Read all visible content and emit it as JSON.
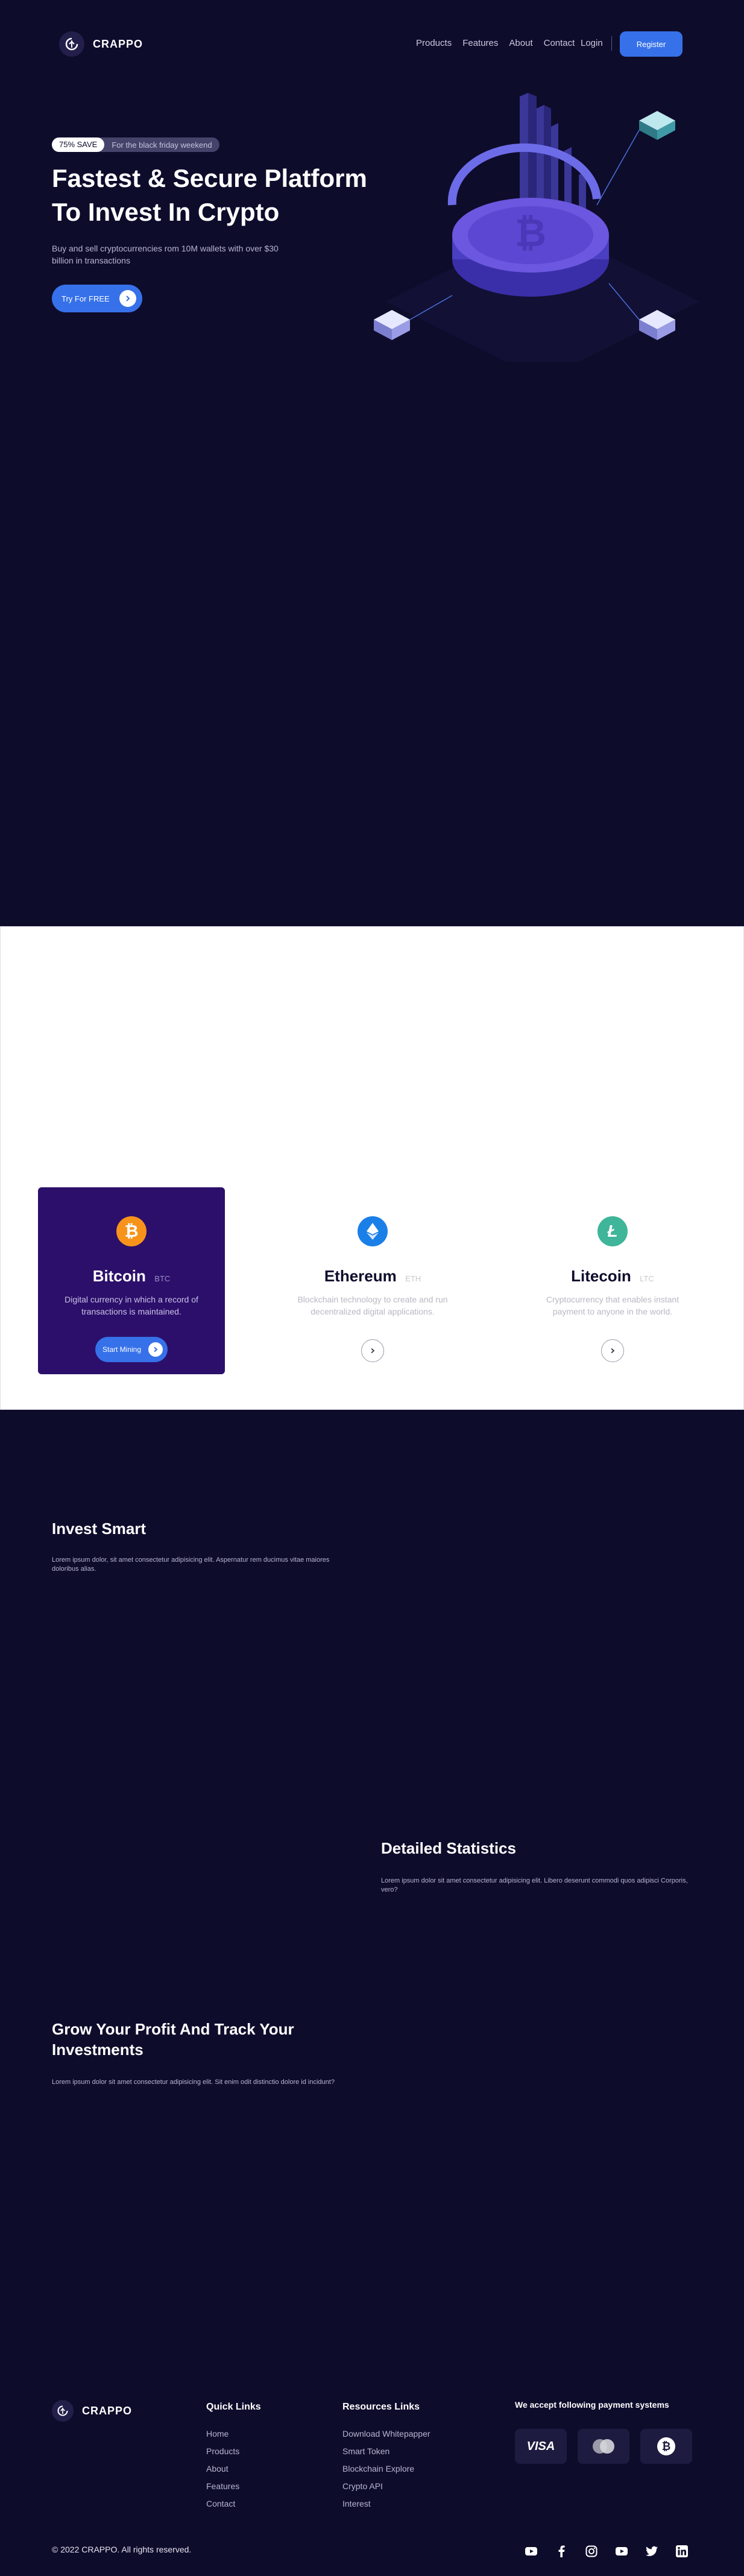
{
  "nav": {
    "brand": "CRAPPO",
    "links": [
      "Products",
      "Features",
      "About",
      "Contact"
    ],
    "login": "Login",
    "register": "Register"
  },
  "hero": {
    "badge_pill": "75% SAVE",
    "badge_text": "For the black friday weekend",
    "title": "Fastest & Secure Platform To Invest In Crypto",
    "subtitle": "Buy and sell cryptocurrencies rom 10M wallets with over $30 billion in transactions",
    "cta": "Try For FREE"
  },
  "coins": [
    {
      "name": "Bitcoin",
      "code": "BTC",
      "desc": "Digital currency in which a record of transactions is maintained.",
      "cta": "Start Mining",
      "color": "#f7931a",
      "active": true
    },
    {
      "name": "Ethereum",
      "code": "ETH",
      "desc": "Blockchain technology to create and run decentralized digital applications.",
      "color": "#1b7fe8",
      "active": false
    },
    {
      "name": "Litecoin",
      "code": "LTC",
      "desc": "Cryptocurrency that enables instant payment to anyone in the world.",
      "color": "#3fb59a",
      "active": false
    }
  ],
  "invest": {
    "title": "Invest Smart",
    "text": "Lorem ipsum dolor, sit amet consectetur adipisicing elit. Aspernatur rem ducimus vitae maiores doloribus alias."
  },
  "stats": {
    "title": "Detailed Statistics",
    "text": "Lorem ipsum dolor sit amet consectetur adipisicing elit. Libero deserunt commodi quos adipisci Corporis, vero?"
  },
  "grow": {
    "title": "Grow Your Profit And Track Your Investments",
    "text": "Lorem ipsum dolor sit amet consectetur adipisicing elit. Sit enim odit distinctio dolore id incidunt?"
  },
  "footer": {
    "brand": "CRAPPO",
    "quick_title": "Quick Links",
    "quick_links": [
      "Home",
      "Products",
      "About",
      "Features",
      "Contact"
    ],
    "resources_title": "Resources Links",
    "resources_links": [
      "Download Whitepapper",
      "Smart Token",
      "Blockchain Explore",
      "Crypto API",
      "Interest"
    ],
    "payment_title": "We accept following payment systems",
    "payment_methods": [
      "VISA",
      "mastercard-icon",
      "bitcoin-icon"
    ],
    "copyright": "© 2022 CRAPPO. All rights reserved.",
    "socials": [
      "youtube-icon",
      "facebook-icon",
      "instagram-icon",
      "youtube-icon",
      "twitter-icon",
      "linkedin-icon"
    ]
  },
  "colors": {
    "background": "#0e0c2b",
    "primary": "#3671e9",
    "card_active": "#2c0f6b"
  }
}
